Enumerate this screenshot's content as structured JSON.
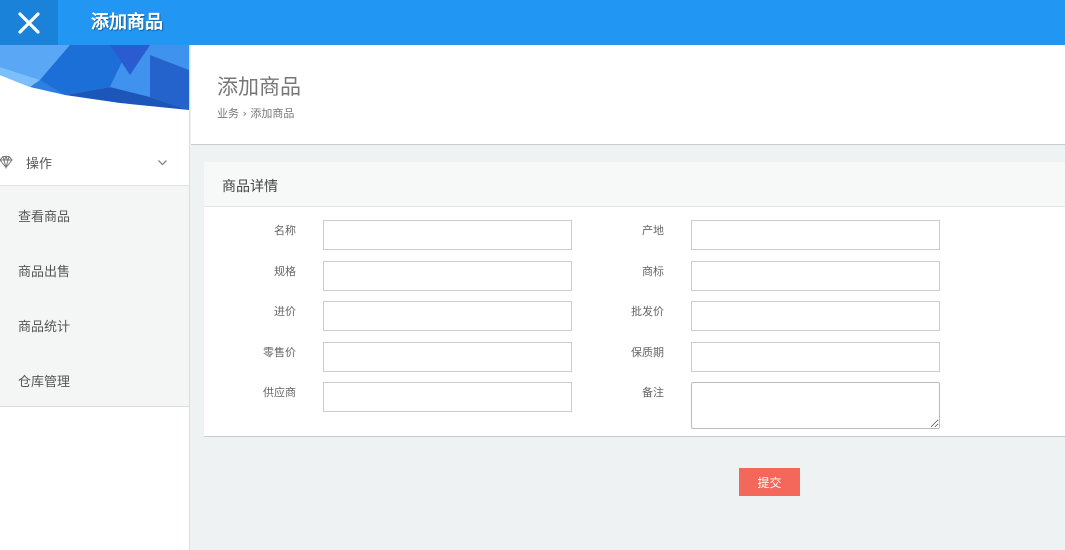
{
  "topbar": {
    "close_icon": "close-icon",
    "title": "添加商品"
  },
  "sidebar": {
    "group": {
      "label": "操作",
      "icon": "diamond-icon",
      "expanded": true
    },
    "items": [
      {
        "label": "查看商品"
      },
      {
        "label": "商品出售"
      },
      {
        "label": "商品统计"
      },
      {
        "label": "仓库管理"
      }
    ]
  },
  "page": {
    "title": "添加商品",
    "breadcrumb": {
      "root": "业务",
      "separator": "›",
      "current": "添加商品"
    }
  },
  "form": {
    "panel_title": "商品详情",
    "left_fields": [
      {
        "label": "名称",
        "value": ""
      },
      {
        "label": "规格",
        "value": ""
      },
      {
        "label": "进价",
        "value": ""
      },
      {
        "label": "零售价",
        "value": ""
      },
      {
        "label": "供应商",
        "value": ""
      }
    ],
    "right_fields": [
      {
        "label": "产地",
        "value": ""
      },
      {
        "label": "商标",
        "value": ""
      },
      {
        "label": "批发价",
        "value": ""
      },
      {
        "label": "保质期",
        "value": ""
      },
      {
        "label": "备注",
        "value": ""
      }
    ],
    "submit_label": "提交"
  },
  "colors": {
    "topbar": "#2196f3",
    "close_bg": "#1a82d9",
    "submit": "#f4675b",
    "content_bg": "#eff2f3"
  }
}
